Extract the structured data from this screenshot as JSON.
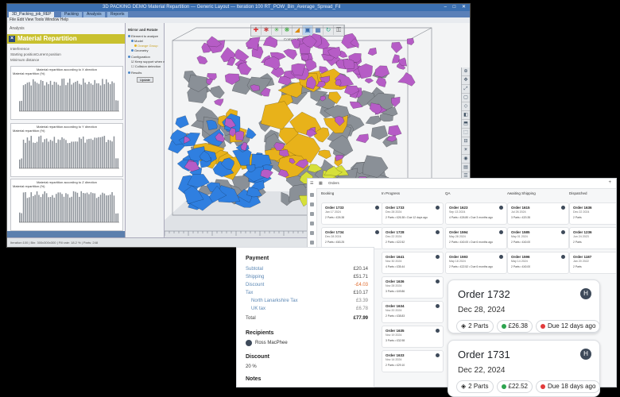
{
  "packing_app": {
    "title_text": "3D PACKING DEMO   Material Repartition — Generic Layout — Iteration 100  RT_POW_Bin_Average_Spread_Fil",
    "tabs": [
      "3D_Packing_job_REP",
      "Packing",
      "Analysis",
      "Reports"
    ],
    "menu_text": "File   Edit   View   Tools   Window   Help",
    "panel_title": "Material Repartition",
    "panel_subtitle": "Analysis",
    "label_repartition": "Interference",
    "label_start": "Starting position",
    "label_current": "Current position",
    "label_minimum": "Minimum distance",
    "histograms": [
      {
        "title": "Material repartition according to X direction",
        "ylabel": "Material repartition (%)"
      },
      {
        "title": "Material repartition according to Y direction",
        "ylabel": "Material repartition (%)"
      },
      {
        "title": "Material repartition according to Z direction",
        "ylabel": "Material repartition (%)"
      }
    ],
    "settings": {
      "header": "Mirror and Rotate",
      "items": [
        "Element to analyze",
        "Model",
        "Orange Group",
        "Geometry",
        "Configuration",
        "Keep support when moving",
        "Collision detection",
        "Results"
      ],
      "button": "Update"
    },
    "viewport_label": "Composition and Packing",
    "toolbar_icons": [
      "move-icon",
      "rotate-icon",
      "select-icon",
      "mirror-icon",
      "measure-icon",
      "view-icon",
      "grid-icon",
      "refresh-icon",
      "lock-icon"
    ],
    "status_text": "Iteration:100  |  Bin: 300x300x300  |  Fill rate: 18.2 %  |  Parts: 248"
  },
  "orders_board": {
    "columns": [
      {
        "name": "Booking",
        "cards": [
          {
            "title": "Order 1733",
            "date": "Jan 17 2024",
            "meta": "2 Parts  •  £26.38"
          },
          {
            "title": "Order 1734",
            "date": "Dec 28 2024",
            "meta": "2 Parts  •  £63.25"
          }
        ]
      },
      {
        "name": "In Progress",
        "cards": [
          {
            "title": "Order 1733",
            "date": "Dec 28 2024",
            "meta": "2 Parts  •  £26.38  •  Due 12 days ago"
          },
          {
            "title": "Order 1728",
            "date": "Dec 22 2024",
            "meta": "2 Parts  •  £22.52"
          },
          {
            "title": "Order 1641",
            "date": "Nov 30 2024",
            "meta": "4 Parts  •  £35.44"
          },
          {
            "title": "Order 1636",
            "date": "Nov 28 2024",
            "meta": "3 Parts  •  £49.86"
          },
          {
            "title": "Order 1634",
            "date": "Nov 20 2024",
            "meta": "2 Parts  •  £38.83"
          },
          {
            "title": "Order 1635",
            "date": "Nov 19 2024",
            "meta": "3 Parts  •  £32.98"
          },
          {
            "title": "Order 1633",
            "date": "Nov 14 2024",
            "meta": "2 Parts  •  £29.10"
          }
        ]
      },
      {
        "name": "QA",
        "cards": [
          {
            "title": "Order 1623",
            "date": "Sep 13 2024",
            "meta": "4 Parts  •  £26.80  •  Due 3 months ago"
          },
          {
            "title": "Order 1594",
            "date": "May 28 2024",
            "meta": "2 Parts  •  £40.00  •  Due 6 months ago"
          },
          {
            "title": "Order 1593",
            "date": "May 18 2024",
            "meta": "2 Parts  •  £22.52  •  Due 6 months ago"
          }
        ]
      },
      {
        "name": "Awaiting Shipping",
        "cards": [
          {
            "title": "Order 1615",
            "date": "Jul 26 2024",
            "meta": "3 Parts  •  £20.35"
          },
          {
            "title": "Order 1585",
            "date": "May 01 2024",
            "meta": "2 Parts  •  £40.00"
          },
          {
            "title": "Order 1596",
            "date": "May 14 2024",
            "meta": "2 Parts  •  £40.00"
          }
        ]
      },
      {
        "name": "Dispatched",
        "cards": [
          {
            "title": "Order 1636",
            "date": "Dec 22 2024",
            "meta": "2 Parts"
          },
          {
            "title": "Order 1236",
            "date": "Jun 24 2023",
            "meta": "2 Parts"
          },
          {
            "title": "Order 1187",
            "date": "Jan 20 2022",
            "meta": "2 Parts"
          }
        ]
      }
    ],
    "search_hint": "Orders",
    "big_cards": [
      {
        "title": "Order 1732",
        "date": "Dec 28, 2024",
        "parts": "2 Parts",
        "price": "£26.38",
        "due": "Due 12 days ago",
        "avatar": "H"
      },
      {
        "title": "Order 1731",
        "date": "Dec 22, 2024",
        "parts": "2 Parts",
        "price": "£22.52",
        "due": "Due 18 days ago",
        "avatar": "H"
      }
    ]
  },
  "payment": {
    "heading": "Payment",
    "rows": [
      {
        "label": "Subtotal",
        "value": "£20.14"
      },
      {
        "label": "Shipping",
        "value": "£51.71"
      },
      {
        "label": "Discount",
        "value": "-£4.03"
      },
      {
        "label": "Tax",
        "value": "£10.17"
      },
      {
        "label": "North Lanarkshire Tax",
        "value": "£3.39"
      },
      {
        "label": "UK tax",
        "value": "£6.78"
      },
      {
        "label": "Total",
        "value": "£77.99"
      }
    ],
    "recipients_heading": "Recipients",
    "recipient_name": "Ross MacPhee",
    "discount_heading": "Discount",
    "discount_value": "20 %",
    "notes_heading": "Notes"
  },
  "colors": {
    "panel_title_bg": "#c9c12f",
    "due_red": "#e23c3c",
    "price_green": "#2ea44f",
    "parts_purple": "#b65cc6",
    "parts_yellow": "#e8b21a",
    "parts_blue": "#2f7fe0",
    "parts_grey": "#8a9097",
    "parts_lime": "#d6e03a"
  }
}
